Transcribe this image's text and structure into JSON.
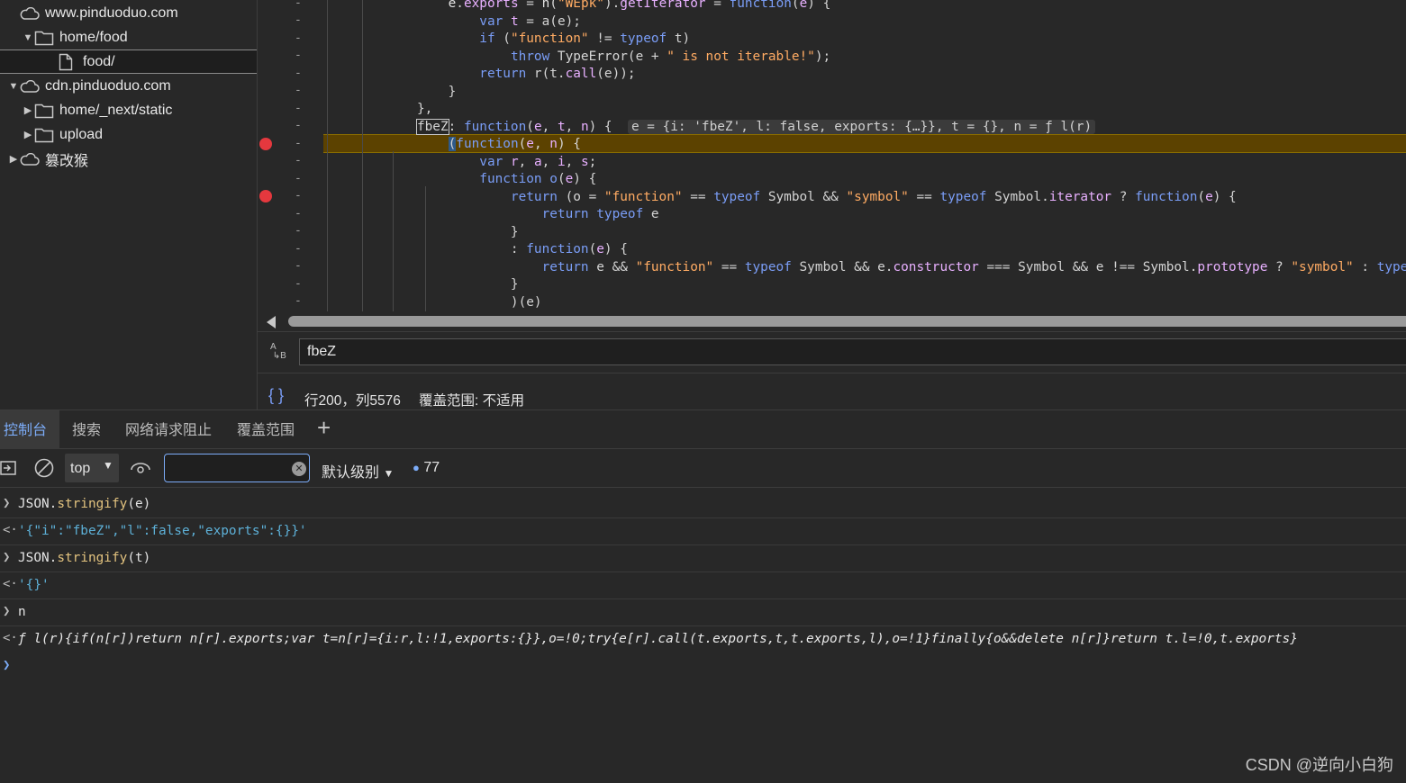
{
  "tree": {
    "items": [
      {
        "label": "www.pinduoduo.com",
        "expanded": true
      },
      {
        "label": "home/food",
        "expanded": true
      },
      {
        "label": "food/",
        "selected": true
      },
      {
        "label": "cdn.pinduoduo.com",
        "expanded": true
      },
      {
        "label": "home/_next/static",
        "expanded": false
      },
      {
        "label": "upload",
        "expanded": false
      },
      {
        "label": "篡改猴",
        "expanded": false
      }
    ]
  },
  "editor": {
    "inline_values": "e = {i: 'fbeZ', l: false, exports: {…}}, t = {}, n = ƒ l(r)",
    "dash": "-"
  },
  "search": {
    "value": "fbeZ",
    "icon": "match-case-icon"
  },
  "status": {
    "brackets": "{ }",
    "position": "行200，列5576",
    "coverage": "覆盖范围: 不适用"
  },
  "drawer": {
    "tabs": [
      "控制台",
      "搜索",
      "网络请求阻止",
      "覆盖范围"
    ],
    "add_label": "+"
  },
  "console_toolbar": {
    "context": "top",
    "filter_value": "",
    "level": "默认级别",
    "issue_count": "77"
  },
  "console": {
    "rows": [
      {
        "kind": "input",
        "text": "JSON.stringify(e)"
      },
      {
        "kind": "output",
        "text": "'{\"i\":\"fbeZ\",\"l\":false,\"exports\":{}}'"
      },
      {
        "kind": "input",
        "text": "JSON.stringify(t)"
      },
      {
        "kind": "output",
        "text": "'{}'"
      },
      {
        "kind": "input",
        "text": "n"
      },
      {
        "kind": "output",
        "text": "ƒ l(r){if(n[r])return n[r].exports;var t=n[r]={i:r,l:!1,exports:{}},o=!0;try{e[r].call(t.exports,t,t.exports,l),o=!1}finally{o&&delete n[r]}return t.l=!0,t.exports}"
      }
    ]
  },
  "watermark": "CSDN @逆向小白狗"
}
